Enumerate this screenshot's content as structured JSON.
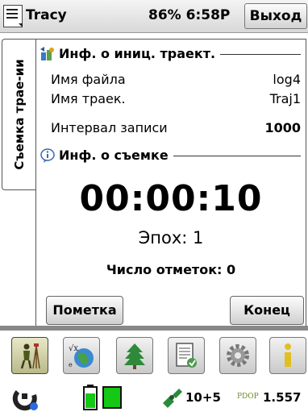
{
  "titlebar": {
    "app_name": "Tracy",
    "status": "86% 6:58P",
    "exit_label": "Выход"
  },
  "side_tab": {
    "label": "Съемка трае-ии"
  },
  "traj_info": {
    "heading": "Инф. о иниц. траект.",
    "rows": [
      {
        "label": "Имя файла",
        "value": "log4"
      },
      {
        "label": "Имя траек.",
        "value": "Traj1"
      },
      {
        "label": "Интервал записи",
        "value": "1000"
      }
    ]
  },
  "survey_info": {
    "heading": "Инф. о съемке",
    "timer": "00:00:10",
    "epochs": "Эпох: 1",
    "marks": "Число отметок: 0"
  },
  "buttons": {
    "mark": "Пометка",
    "end": "Конец"
  },
  "toolbar": {
    "icons": [
      "surveyor-icon",
      "coordinates-globe-icon",
      "tree-icon",
      "document-icon",
      "gear-icon",
      "info-icon"
    ]
  },
  "statusbar": {
    "satellites": "10+5",
    "pdop_label": "PDOP",
    "pdop_value": "1.557"
  }
}
